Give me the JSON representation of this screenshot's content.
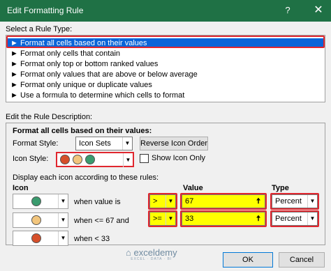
{
  "window": {
    "title": "Edit Formatting Rule",
    "help_glyph": "?",
    "close_glyph": "✕"
  },
  "rule_type": {
    "label": "Select a Rule Type:",
    "items": [
      "► Format all cells based on their values",
      "► Format only cells that contain",
      "► Format only top or bottom ranked values",
      "► Format only values that are above or below average",
      "► Format only unique or duplicate values",
      "► Use a formula to determine which cells to format"
    ]
  },
  "description": {
    "label": "Edit the Rule Description:",
    "heading": "Format all cells based on their values:",
    "format_style_label": "Format Style:",
    "format_style_value": "Icon Sets",
    "reverse_button": "Reverse Icon Order",
    "icon_style_label": "Icon Style:",
    "show_icon_only": "Show Icon Only",
    "rules_intro": "Display each icon according to these rules:",
    "col_icon": "Icon",
    "col_value": "Value",
    "col_type": "Type",
    "rows": [
      {
        "condition": "when value is",
        "operator": ">",
        "value": "67",
        "type": "Percent",
        "icon_color": "#3a9b6e"
      },
      {
        "condition": "when <= 67 and",
        "operator": ">=",
        "value": "33",
        "type": "Percent",
        "icon_color": "#f2c57c"
      },
      {
        "condition": "when < 33",
        "icon_color": "#d64f2a"
      }
    ]
  },
  "footer": {
    "ok": "OK",
    "cancel": "Cancel"
  },
  "watermark": {
    "brand": "exceldemy",
    "tagline": "EXCEL · DATA · BI"
  },
  "colors": {
    "title_bar": "#1f7145",
    "selection": "#0a64d8",
    "highlight_box": "#e0262e",
    "field_highlight": "#ffff00"
  }
}
